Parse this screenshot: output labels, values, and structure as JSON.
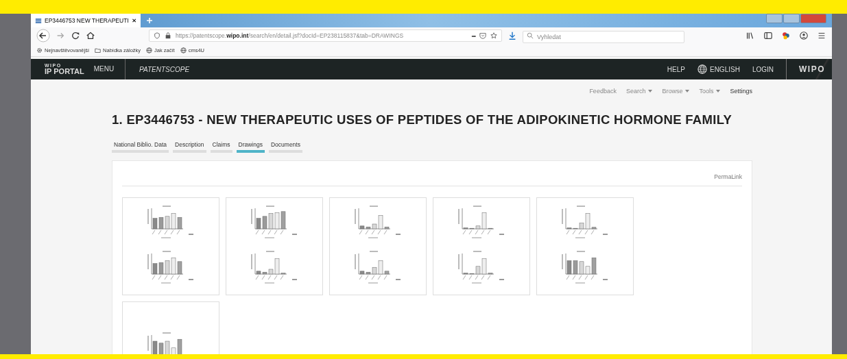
{
  "browser": {
    "tab_title": "EP3446753 NEW THERAPEUTI",
    "url": "https://patentscope.**wipo.int**/search/en/detail.jsf?docId=EP238115837&tab=DRAWINGS",
    "page_actions": "•••",
    "search_placeholder": "Vyhledat",
    "bookmarks": [
      {
        "kind": "gear",
        "label": "Nejnavštěvovanější"
      },
      {
        "kind": "folder",
        "label": "Nabídka záložky"
      },
      {
        "kind": "globe",
        "label": "Jak začít"
      },
      {
        "kind": "globe",
        "label": "cms4U"
      }
    ]
  },
  "portal_bar": {
    "logo_top": "WIPO",
    "logo_bottom": "IP PORTAL",
    "menu": "MENU",
    "product": "PATENTSCOPE",
    "help": "HELP",
    "language": "ENGLISH",
    "login": "LOGIN",
    "brand": "WIPO"
  },
  "top_links": [
    {
      "label": "Feedback",
      "has_menu": false
    },
    {
      "label": "Search",
      "has_menu": true
    },
    {
      "label": "Browse",
      "has_menu": true
    },
    {
      "label": "Tools",
      "has_menu": true
    },
    {
      "label": "Settings",
      "has_menu": false
    }
  ],
  "title": "1. EP3446753 - NEW THERAPEUTIC USES OF PEPTIDES OF THE ADIPOKINETIC HORMONE FAMILY",
  "tabs": [
    {
      "label": "National Biblio. Data",
      "selected": false
    },
    {
      "label": "Description",
      "selected": false
    },
    {
      "label": "Claims",
      "selected": false
    },
    {
      "label": "Drawings",
      "selected": true
    },
    {
      "label": "Documents",
      "selected": false
    }
  ],
  "permalink": "PermaLink",
  "drawings": [
    {
      "kind": "double"
    },
    {
      "kind": "double"
    },
    {
      "kind": "double"
    },
    {
      "kind": "double"
    },
    {
      "kind": "double"
    },
    {
      "kind": "single"
    }
  ]
}
